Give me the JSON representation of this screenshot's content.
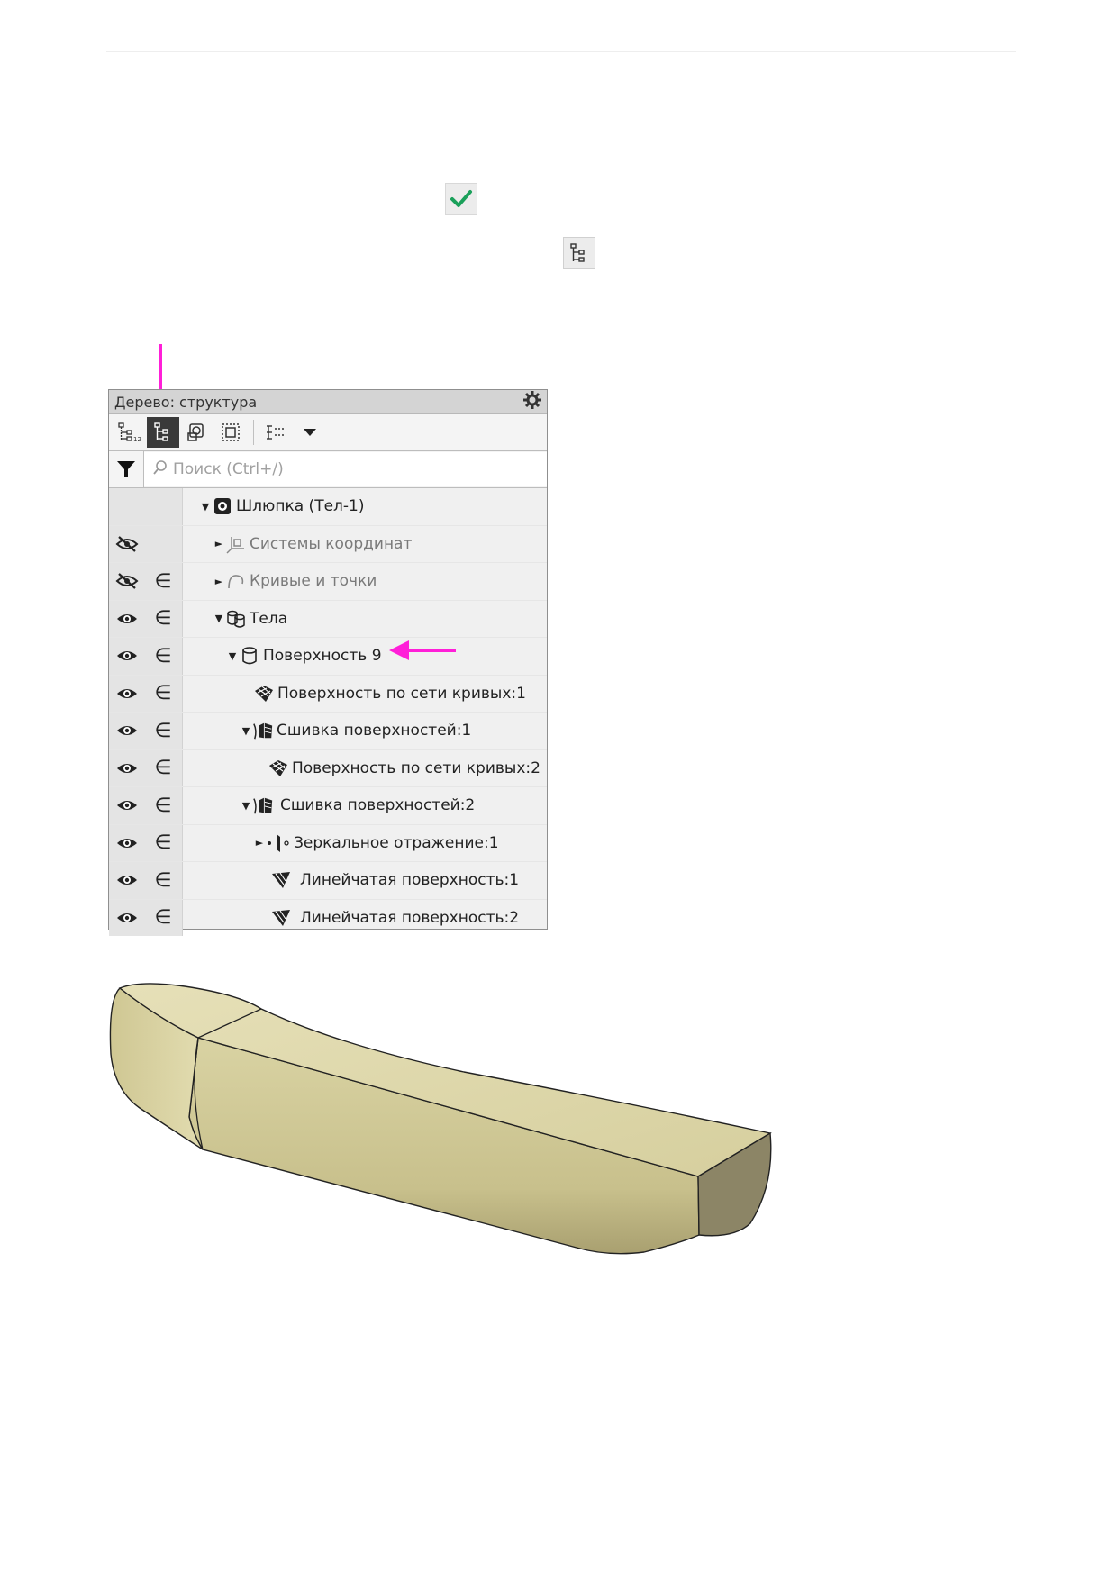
{
  "panel": {
    "title": "Дерево: структура",
    "search_placeholder": "Поиск (Ctrl+/)"
  },
  "tree": {
    "rows": [
      {
        "label": "Шлюпка (Тел-1)"
      },
      {
        "label": "Системы координат"
      },
      {
        "label": "Кривые и точки"
      },
      {
        "label": "Тела"
      },
      {
        "label": "Поверхность 9"
      },
      {
        "label": "Поверхность по сети кривых:1"
      },
      {
        "label": "Сшивка поверхностей:1"
      },
      {
        "label": "Поверхность по сети кривых:2"
      },
      {
        "label": "Сшивка поверхностей:2"
      },
      {
        "label": "Зеркальное отражение:1"
      },
      {
        "label": "Линейчатая поверхность:1"
      },
      {
        "label": "Линейчатая поверхность:2"
      }
    ],
    "element_symbol": "∈"
  },
  "colors": {
    "accent_arrow": "#ff1fd8",
    "check": "#1aa05a",
    "hull": "#d8d2a4"
  }
}
